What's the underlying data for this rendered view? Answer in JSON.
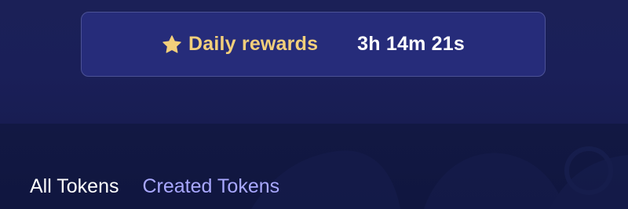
{
  "rewards": {
    "icon": "star-icon",
    "label": "Daily rewards",
    "timer": "3h 14m 21s"
  },
  "tabs": [
    {
      "label": "All Tokens"
    },
    {
      "label": "Created Tokens"
    }
  ],
  "colors": {
    "card_bg": "#262c7a",
    "label_gold": "#f3cf7b",
    "tab_active": "#ffffff",
    "tab_link": "#a9a8ff"
  }
}
